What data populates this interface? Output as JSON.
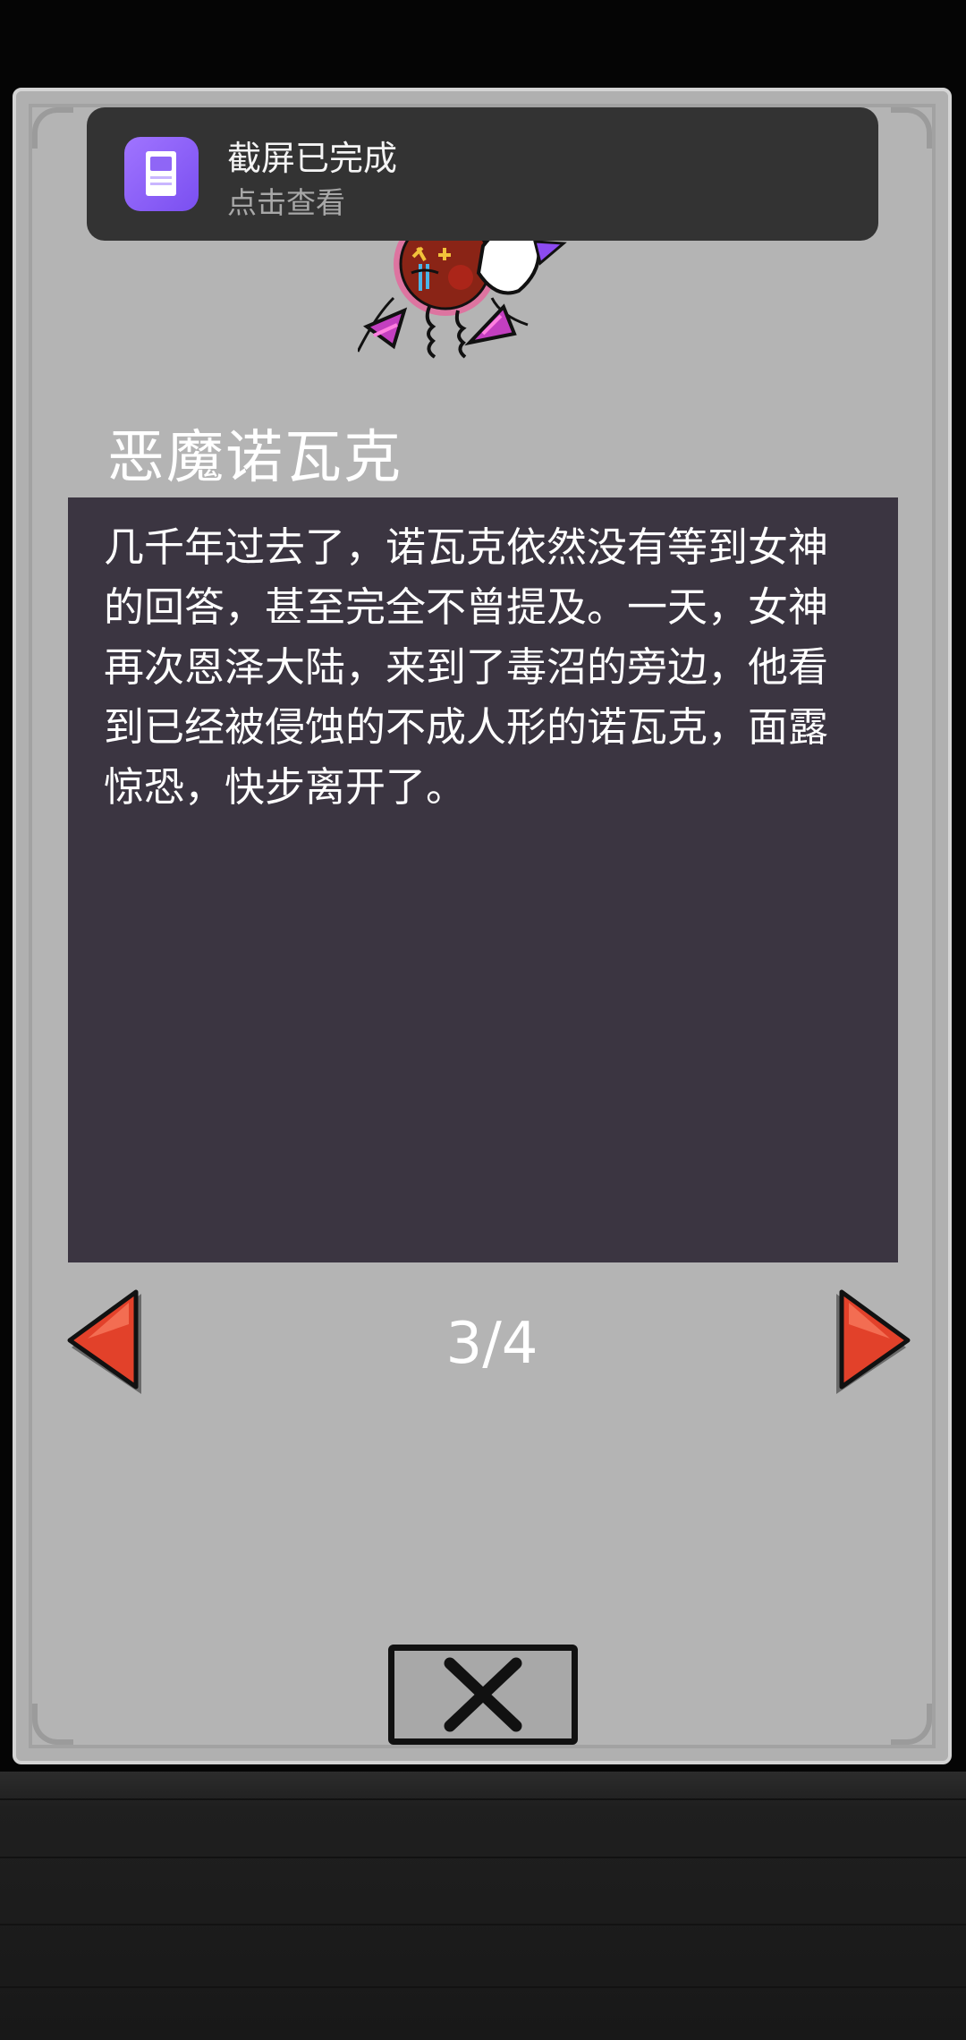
{
  "notification": {
    "title": "截屏已完成",
    "subtitle": "点击查看",
    "icon": "screenshot-icon"
  },
  "character": {
    "name": "恶魔诺瓦克",
    "sprite": "demon-novak-sprite"
  },
  "story": {
    "text": "几千年过去了，诺瓦克依然没有等到女神的回答，甚至完全不曾提及。一天，女神再次恩泽大陆，来到了毒沼的旁边，他看到已经被侵蚀的不成人形的诺瓦克，面露惊恐，快步离开了。"
  },
  "pager": {
    "indicator": "3/4",
    "current": 3,
    "total": 4,
    "prev_icon": "arrow-left-icon",
    "next_icon": "arrow-right-icon"
  },
  "close": {
    "icon": "close-icon"
  },
  "colors": {
    "panel": "#b4b4b4",
    "story_bg": "#3b3541",
    "arrow": "#e2412a",
    "notification_bg": "#333333",
    "notification_icon": "#9a6cff"
  }
}
